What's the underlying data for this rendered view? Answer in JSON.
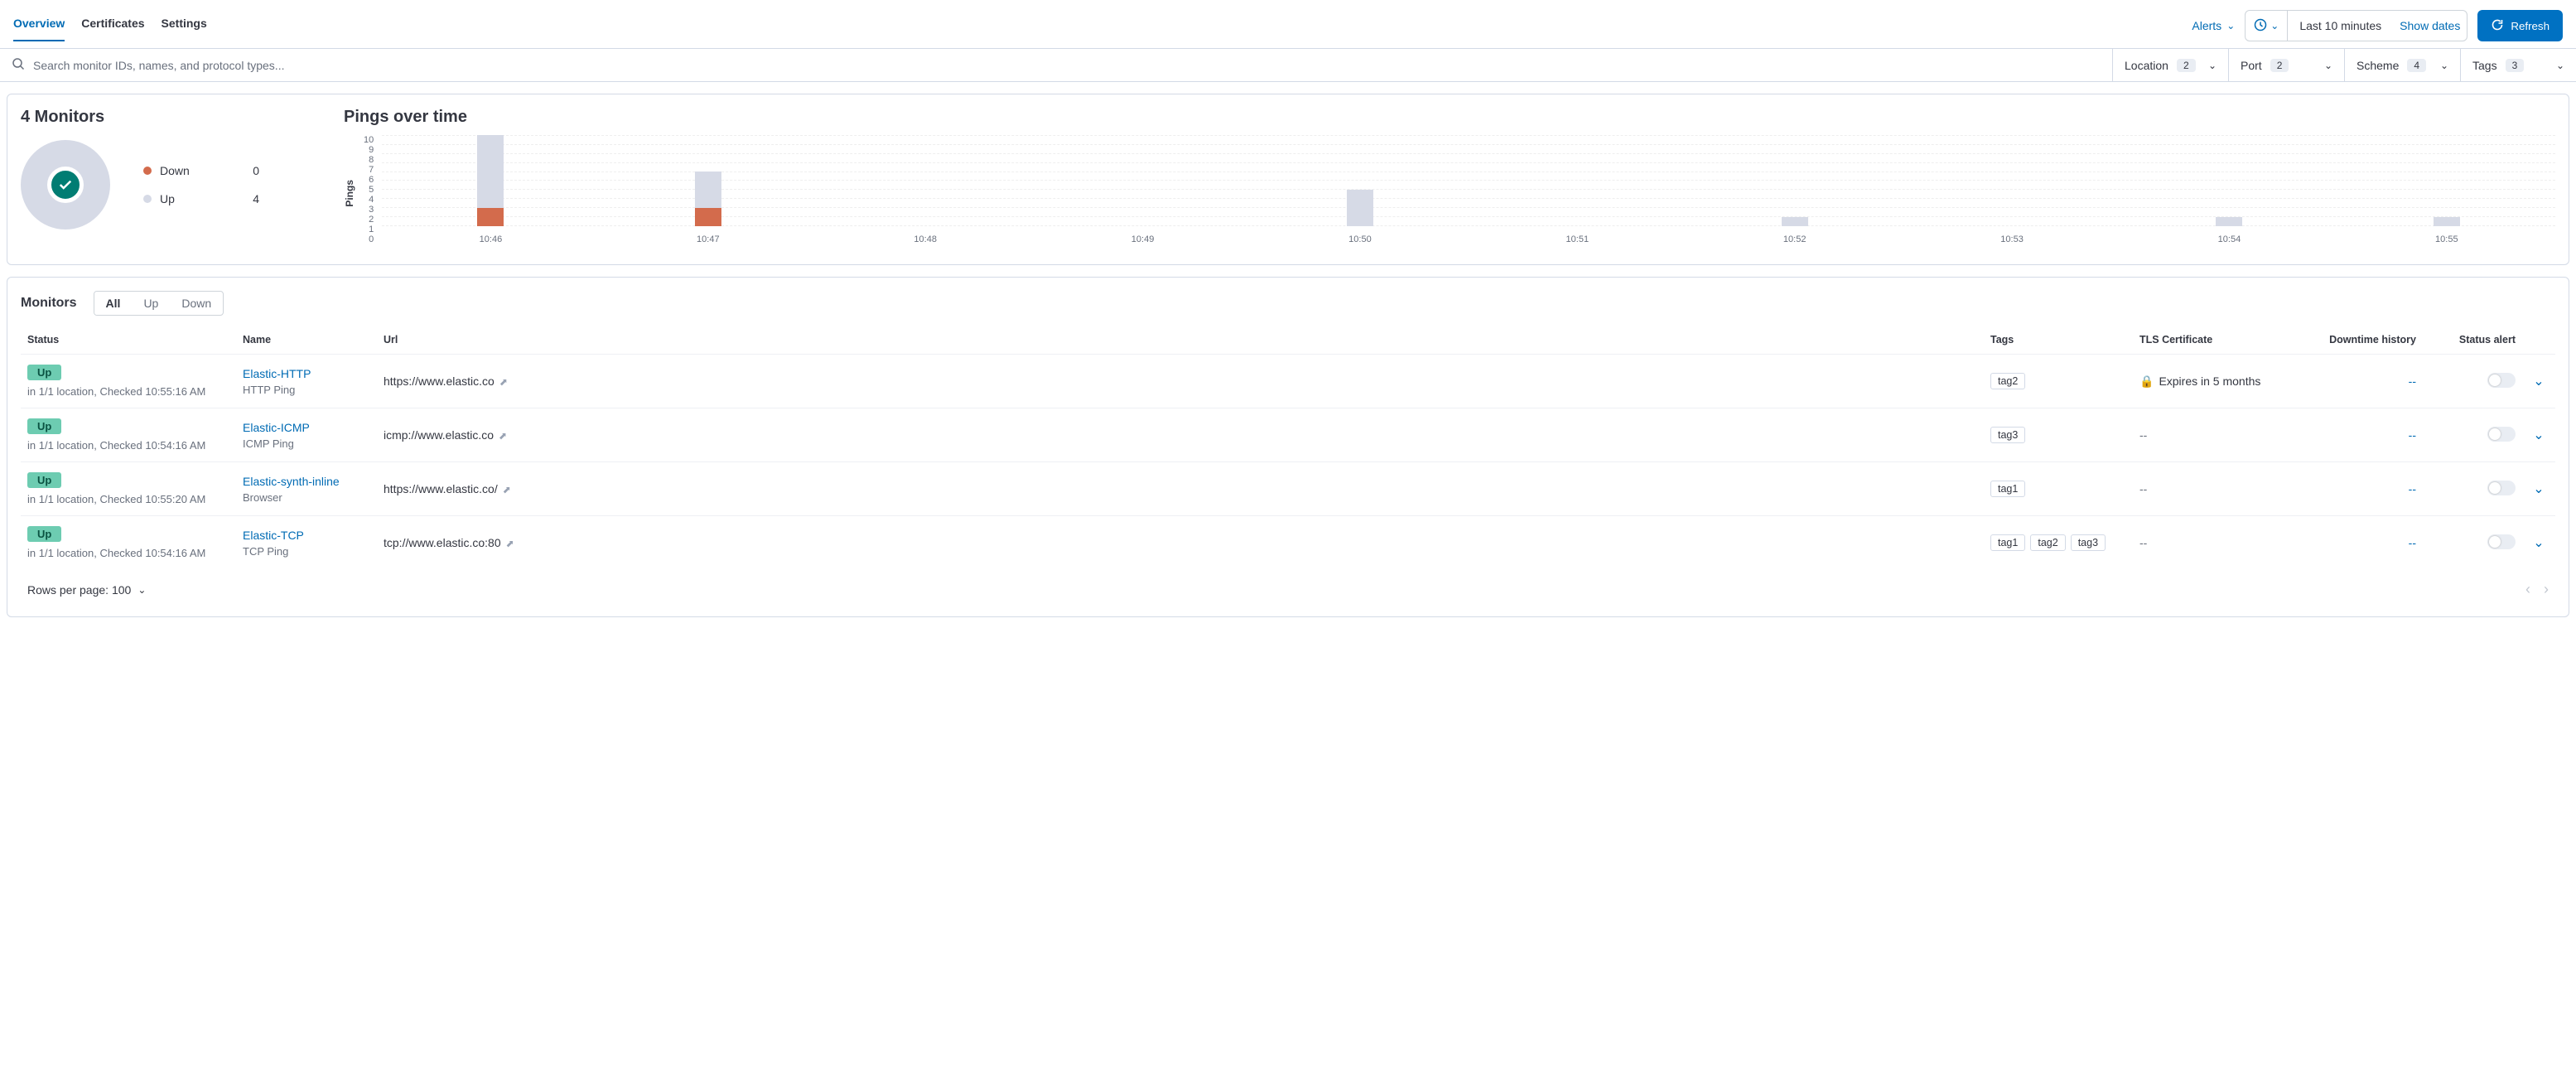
{
  "tabs": {
    "overview": "Overview",
    "certificates": "Certificates",
    "settings": "Settings"
  },
  "alerts_label": "Alerts",
  "time_range": "Last 10 minutes",
  "show_dates": "Show dates",
  "refresh": "Refresh",
  "search_placeholder": "Search monitor IDs, names, and protocol types...",
  "filters": {
    "location": {
      "label": "Location",
      "count": "2"
    },
    "port": {
      "label": "Port",
      "count": "2"
    },
    "scheme": {
      "label": "Scheme",
      "count": "4"
    },
    "tags": {
      "label": "Tags",
      "count": "3"
    }
  },
  "summary": {
    "title": "4 Monitors",
    "down_label": "Down",
    "down_count": "0",
    "up_label": "Up",
    "up_count": "4"
  },
  "pings_title": "Pings over time",
  "chart_data": {
    "type": "bar",
    "ylabel": "Pings",
    "ylim": [
      0,
      10
    ],
    "yticks": [
      0,
      1,
      2,
      3,
      4,
      5,
      6,
      7,
      8,
      9,
      10
    ],
    "categories": [
      "10:46",
      "10:47",
      "10:48",
      "10:49",
      "10:50",
      "10:51",
      "10:52",
      "10:53",
      "10:54",
      "10:55"
    ],
    "series": [
      {
        "name": "Up",
        "color": "#d6dae6",
        "values": [
          8,
          4,
          0,
          0,
          4,
          0,
          1,
          0,
          1,
          1
        ]
      },
      {
        "name": "Down",
        "color": "#d36b4c",
        "values": [
          2,
          2,
          0,
          0,
          0,
          0,
          0,
          0,
          0,
          0
        ]
      }
    ]
  },
  "monitors_header": "Monitors",
  "filter_tabs": {
    "all": "All",
    "up": "Up",
    "down": "Down"
  },
  "columns": {
    "status": "Status",
    "name": "Name",
    "url": "Url",
    "tags": "Tags",
    "tls": "TLS Certificate",
    "downtime": "Downtime history",
    "alert": "Status alert"
  },
  "rows": [
    {
      "status": "Up",
      "status_sub": "in 1/1 location, Checked 10:55:16 AM",
      "name": "Elastic-HTTP",
      "name_sub": "HTTP Ping",
      "url": "https://www.elastic.co",
      "tags": [
        "tag2"
      ],
      "tls": "Expires in 5 months",
      "tls_lock": true,
      "downtime": "--"
    },
    {
      "status": "Up",
      "status_sub": "in 1/1 location, Checked 10:54:16 AM",
      "name": "Elastic-ICMP",
      "name_sub": "ICMP Ping",
      "url": "icmp://www.elastic.co",
      "tags": [
        "tag3"
      ],
      "tls": "--",
      "tls_lock": false,
      "downtime": "--"
    },
    {
      "status": "Up",
      "status_sub": "in 1/1 location, Checked 10:55:20 AM",
      "name": "Elastic-synth-inline",
      "name_sub": "Browser",
      "url": "https://www.elastic.co/",
      "tags": [
        "tag1"
      ],
      "tls": "--",
      "tls_lock": false,
      "downtime": "--"
    },
    {
      "status": "Up",
      "status_sub": "in 1/1 location, Checked 10:54:16 AM",
      "name": "Elastic-TCP",
      "name_sub": "TCP Ping",
      "url": "tcp://www.elastic.co:80",
      "tags": [
        "tag1",
        "tag2",
        "tag3"
      ],
      "tls": "--",
      "tls_lock": false,
      "downtime": "--"
    }
  ],
  "rows_per_page": "Rows per page: 100"
}
